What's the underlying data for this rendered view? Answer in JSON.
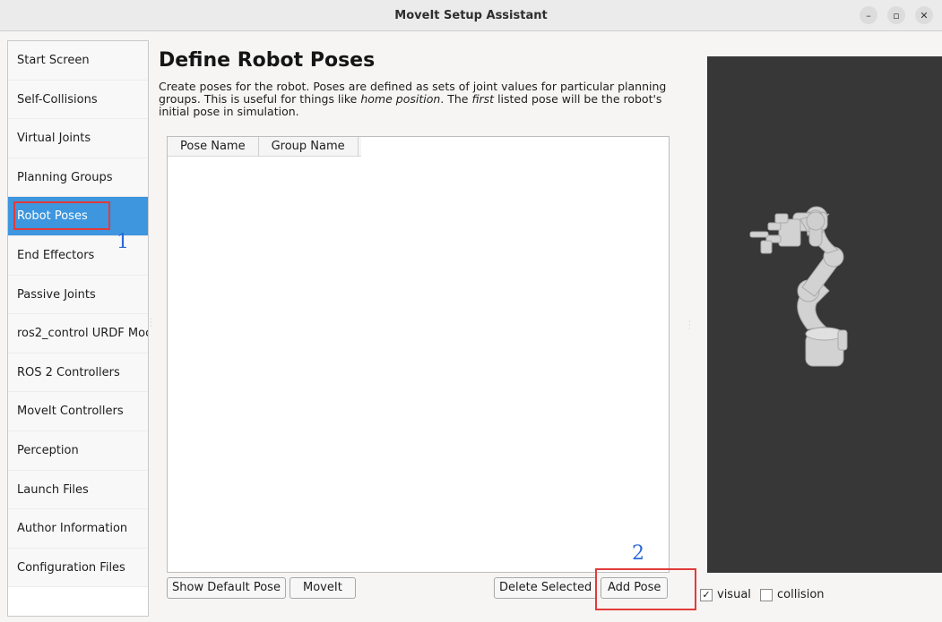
{
  "window": {
    "title": "MoveIt Setup Assistant",
    "controls": [
      "minimize-icon",
      "maximize-icon",
      "close-icon"
    ]
  },
  "sidebar": {
    "items": [
      {
        "label": "Start Screen"
      },
      {
        "label": "Self-Collisions"
      },
      {
        "label": "Virtual Joints"
      },
      {
        "label": "Planning Groups"
      },
      {
        "label": "Robot Poses",
        "active": true
      },
      {
        "label": "End Effectors"
      },
      {
        "label": "Passive Joints"
      },
      {
        "label": "ros2_control URDF Moc"
      },
      {
        "label": "ROS 2 Controllers"
      },
      {
        "label": "MoveIt Controllers"
      },
      {
        "label": "Perception"
      },
      {
        "label": "Launch Files"
      },
      {
        "label": "Author Information"
      },
      {
        "label": "Configuration Files"
      }
    ]
  },
  "main": {
    "heading": "Define Robot Poses",
    "description_1": "Create poses for the robot. Poses are defined as sets of joint values for particular planning groups. This is useful for things like ",
    "description_em1": "home position",
    "description_2": ". The ",
    "description_em2": "first",
    "description_3": " listed pose will be the robot's initial pose in simulation.",
    "table": {
      "columns": [
        "Pose Name",
        "Group Name"
      ],
      "rows": []
    },
    "buttons": {
      "show_default_pose": "Show Default Pose",
      "moveit": "MoveIt",
      "delete_selected": "Delete Selected",
      "add_pose": "Add Pose"
    }
  },
  "viewer": {
    "visual_label": "visual",
    "visual_checked": true,
    "collision_label": "collision",
    "collision_checked": false
  },
  "annotations": {
    "marker_1": "1",
    "marker_2": "2",
    "highlight_color": "#e23a3a",
    "marker_color": "#2a6ad8"
  },
  "colors": {
    "accent": "#3d96de",
    "viewport_bg": "#373737"
  }
}
